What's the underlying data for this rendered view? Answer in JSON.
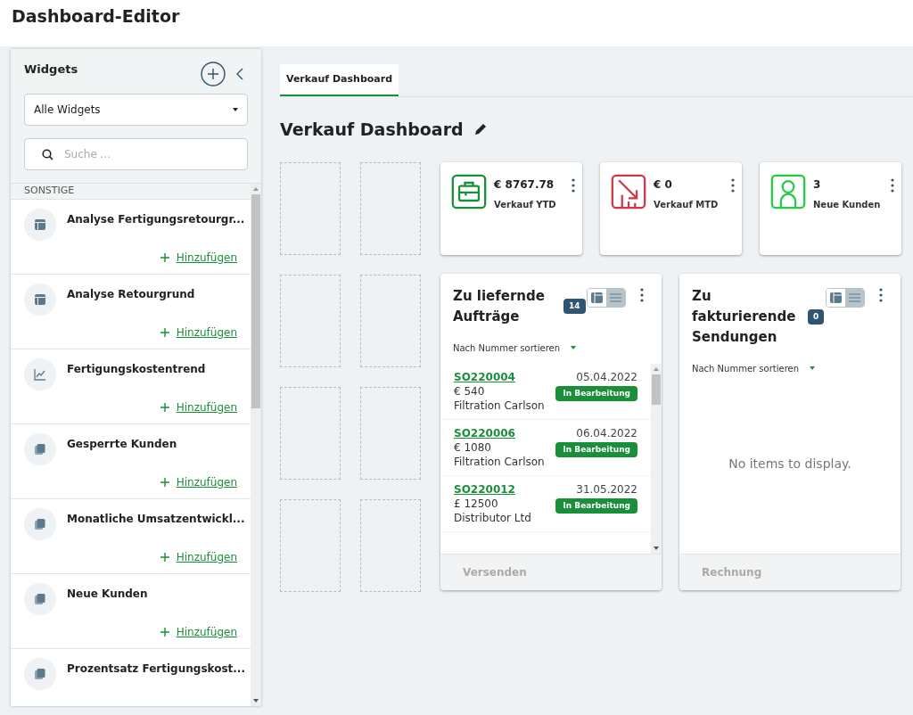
{
  "app_title": "Dashboard-Editor",
  "sidebar": {
    "title": "Widgets",
    "filter": {
      "value": "Alle Widgets"
    },
    "search": {
      "placeholder": "Suche ..."
    },
    "section": "SONSTIGE",
    "items": [
      {
        "name": "Analyse Fertigungsretourgr...",
        "kind": "table",
        "action": "Hinzufügen"
      },
      {
        "name": "Analyse Retourgrund",
        "kind": "table",
        "action": "Hinzufügen"
      },
      {
        "name": "Fertigungskostentrend",
        "kind": "chart",
        "action": "Hinzufügen"
      },
      {
        "name": "Gesperrte Kunden",
        "kind": "stack",
        "action": "Hinzufügen"
      },
      {
        "name": "Monatliche Umsatzentwickl...",
        "kind": "stack",
        "action": "Hinzufügen"
      },
      {
        "name": "Neue Kunden",
        "kind": "stack",
        "action": "Hinzufügen"
      },
      {
        "name": "Prozentsatz Fertigungskost...",
        "kind": "stack"
      }
    ]
  },
  "tabs": [
    {
      "label": "Verkauf Dashboard",
      "selected": true
    }
  ],
  "dashboard_title": "Verkauf Dashboard",
  "kpis": [
    {
      "value": "€ 8767.78",
      "label": "Verkauf YTD",
      "kind": "briefcase",
      "color": "#1a8f3a"
    },
    {
      "value": "€ 0",
      "label": "Verkauf MTD",
      "kind": "trend",
      "color": "#d0364a"
    },
    {
      "value": "3",
      "label": "Neue Kunden",
      "kind": "person",
      "color": "#22cc44"
    }
  ],
  "lists": [
    {
      "title": "Zu liefernde Aufträge",
      "count": "14",
      "card_view": true,
      "sort": "Nach Nummer sortieren",
      "footer": "Versenden",
      "rows": [
        {
          "id": "SO220004",
          "date": "05.04.2022",
          "amount": "€ 540",
          "customer": "Filtration Carlson",
          "status": "In Bearbeitung"
        },
        {
          "id": "SO220006",
          "date": "06.04.2022",
          "amount": "€ 1080",
          "customer": "Filtration Carlson",
          "status": "In Bearbeitung"
        },
        {
          "id": "SO220012",
          "date": "31.05.2022",
          "amount": "£ 12500",
          "customer": "Distributor Ltd",
          "status": "In Bearbeitung"
        }
      ]
    },
    {
      "title": "Zu fakturierende Sendungen",
      "count": "0",
      "card_view": true,
      "sort": "Nach Nummer sortieren",
      "footer": "Rechnung",
      "empty": "No items to display."
    }
  ]
}
